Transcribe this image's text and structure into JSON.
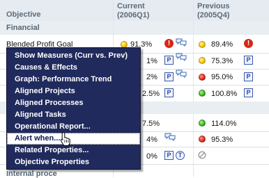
{
  "header": {
    "objective_label": "Objective",
    "current_label": "Current",
    "current_period": "(2006Q1)",
    "previous_label": "Previous",
    "previous_period": "(2005Q4)"
  },
  "section_financial": "Financial",
  "first_row": {
    "label": "Blended Profit Goal",
    "current_value": "91.3%",
    "previous_value": "89.4%"
  },
  "rows": [
    {
      "current_value": "1%",
      "previous_value": "75.3%"
    },
    {
      "current_value": "2%",
      "previous_value": "95.0%"
    },
    {
      "current_value": "2.5%",
      "previous_value": "100.8%"
    },
    {
      "current_value": "7.5%",
      "previous_value": "114.0%"
    },
    {
      "current_value": "4%",
      "previous_value": "95.3%"
    },
    {
      "current_value": "0%"
    }
  ],
  "bottom_partial_label": "Internal proce",
  "context_menu": {
    "items": [
      "Show Measures (Curr vs. Prev)",
      "Causes & Effects",
      "Graph: Performance Trend",
      "Aligned Projects",
      "Aligned Processes",
      "Aligned Tasks",
      "Operational Report...",
      "Alert when...",
      "Related Properties...",
      "Objective Properties"
    ],
    "selected_index": 7
  },
  "icons": {
    "warning": "!",
    "property_badge": "P",
    "target_badge": "T"
  },
  "colors": {
    "menu_background": "#202a5c",
    "header_text": "#5c6b7a",
    "status_yellow": "#f2c200",
    "status_red": "#e0281a",
    "status_green": "#38b51c"
  }
}
